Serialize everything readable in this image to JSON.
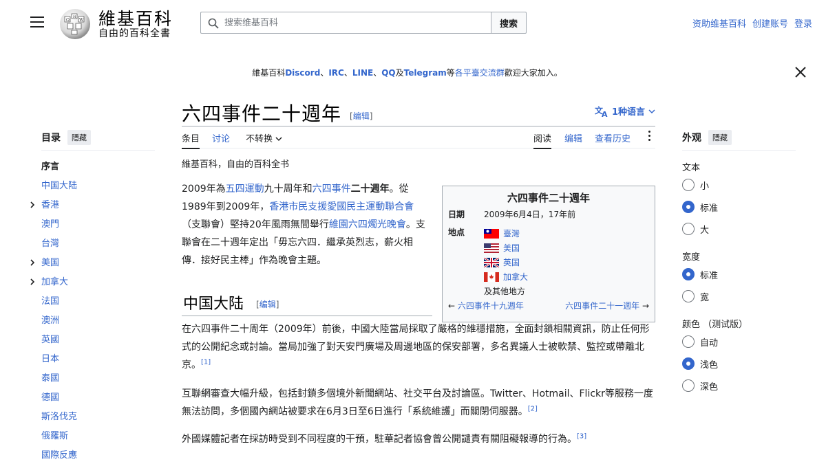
{
  "header": {
    "logo_title": "維基百科",
    "logo_tagline": "自由的百科全書",
    "search_placeholder": "搜索维基百科",
    "search_button": "搜索",
    "user_links": [
      "资助维基百科",
      "创建账号",
      "登录"
    ]
  },
  "sitenotice": {
    "prefix": "維基百科",
    "discord": "Discord",
    "sep1": "、",
    "irc": "IRC",
    "sep2": "、",
    "line": "LINE",
    "sep3": "、",
    "qq": "QQ",
    "and": "及",
    "telegram": "Telegram",
    "mid": "等",
    "groups": "各平臺交流群",
    "suffix": "歡迎大家加入。"
  },
  "toc": {
    "title": "目录",
    "hide": "隱藏",
    "items": [
      {
        "label": "序言",
        "current": true
      },
      {
        "label": "中国大陆"
      },
      {
        "label": "香港",
        "chevron": true
      },
      {
        "label": "澳門"
      },
      {
        "label": "台灣"
      },
      {
        "label": "美国",
        "chevron": true
      },
      {
        "label": "加拿大",
        "chevron": true
      },
      {
        "label": "法国"
      },
      {
        "label": "澳洲"
      },
      {
        "label": "英國"
      },
      {
        "label": "日本"
      },
      {
        "label": "泰國"
      },
      {
        "label": "德國"
      },
      {
        "label": "斯洛伐克"
      },
      {
        "label": "俄羅斯"
      },
      {
        "label": "國際反應"
      }
    ]
  },
  "article": {
    "title": "六四事件二十週年",
    "edit_open": "[",
    "edit": "编辑",
    "edit_close": "]",
    "languages": "1种语言",
    "tabs": {
      "article": "条目",
      "talk": "讨论",
      "variant": "不转换",
      "read": "阅读",
      "edit": "编辑",
      "history": "查看历史"
    },
    "from": "維基百科，自由的百科全书",
    "p1": {
      "t1": "2009年為",
      "l1": "五四運動",
      "t2": "九十周年和",
      "l2": "六四事件",
      "t3": "二十週年",
      "t4": "。從1989年到2009年，",
      "l3": "香港市民支援愛國民主運動聯合會",
      "t5": "（支聯會）堅持20年風雨無間舉行",
      "l4": "維園六四燭光晚會",
      "t6": "。支聯會在二十週年定出「毋忘六四．繼承英烈志，薪火相傳．接好民主棒」作為晚會主題。"
    },
    "section_heading": "中国大陆",
    "p2": "在六四事件二十周年（2009年）前後，中國大陸當局採取了嚴格的維穩措施，全面封鎖相關資訊，防止任何形式的公開紀念或討論。當局加強了對天安門廣場及周邊地區的保安部署，多名異議人士被軟禁、監控或帶離北京。",
    "ref1": "[1]",
    "p3": "互聯網審查大幅升級，包括封鎖多個境外新聞網站、社交平台及討論區。Twitter、Hotmail、Flickr等服務一度無法訪問，多個國內網站被要求在6月3日至6日進行「系統維護」而關閉伺服器。",
    "ref2": "[2]",
    "p4": "外國媒體記者在採訪時受到不同程度的干預，駐華記者協會曾公開譴責有關阻礙報導的行為。",
    "ref3": "[3]"
  },
  "infobox": {
    "title": "六四事件二十週年",
    "date_label": "日期",
    "date_value": "2009年6月4日，17年前",
    "place_label": "地点",
    "places": [
      {
        "name": "臺灣",
        "flag": "taiwan-flag-icon"
      },
      {
        "name": "美国",
        "flag": "usa-flag-icon"
      },
      {
        "name": "英国",
        "flag": "uk-flag-icon"
      },
      {
        "name": "加拿大",
        "flag": "canada-flag-icon"
      }
    ],
    "others": "及其他地方",
    "prev_arrow": "←",
    "prev": "六四事件十九週年",
    "next": "六四事件二十一週年",
    "next_arrow": "→"
  },
  "appearance": {
    "title": "外观",
    "hide": "隱藏",
    "text_label": "文本",
    "text_options": [
      {
        "label": "小",
        "selected": false
      },
      {
        "label": "标准",
        "selected": true
      },
      {
        "label": "大",
        "selected": false
      }
    ],
    "width_label": "宽度",
    "width_options": [
      {
        "label": "标准",
        "selected": true
      },
      {
        "label": "宽",
        "selected": false
      }
    ],
    "color_label": "颜色 （测试版）",
    "color_options": [
      {
        "label": "自动",
        "selected": false
      },
      {
        "label": "浅色",
        "selected": true
      },
      {
        "label": "深色",
        "selected": false
      }
    ]
  },
  "colors": {
    "link": "#3366cc",
    "text": "#202122",
    "infobox_bg": "#f8f9fa",
    "border": "#a2a9b1"
  }
}
